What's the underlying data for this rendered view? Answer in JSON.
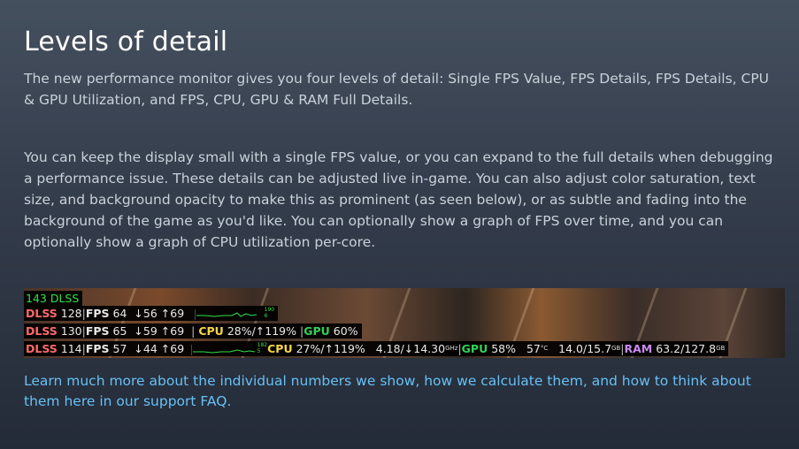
{
  "title": "Levels of detail",
  "para1": "The new performance monitor gives you four levels of detail: Single FPS Value, FPS Details, FPS Details, CPU & GPU Utilization, and FPS, CPU, GPU & RAM Full Details.",
  "para2": "You can keep the display small with a single FPS value, or you can expand to the full details when debugging a performance issue. These details can be adjusted live in-game. You can also adjust color saturation, text size, and background opacity to make this as prominent (as seen below), or as subtle and fading into the background of the game as you'd like. You can optionally show a graph of FPS over time, and you can optionally show a graph of CPU utilization per-core.",
  "link": "Learn much more about the individual numbers we show, how we calculate them, and how to think about them here in our support FAQ.",
  "overlay": {
    "row0": "143 DLSS",
    "row1": {
      "dlss_label": "DLSS",
      "dlss_val": "128",
      "fps_label": "FPS",
      "fps_val": "64",
      "low": "↓56",
      "high": "↑69",
      "graph_max": "190",
      "graph_min": "6"
    },
    "row2": {
      "dlss_label": "DLSS",
      "dlss_val": "130",
      "fps_label": "FPS",
      "fps_val": "65",
      "low": "↓59",
      "high": "↑69",
      "cpu_label": "CPU",
      "cpu_val": "28%/↑119%",
      "gpu_label": "GPU",
      "gpu_val": "60%"
    },
    "row3": {
      "dlss_label": "DLSS",
      "dlss_val": "114",
      "fps_label": "FPS",
      "fps_val": "57",
      "low": "↓44",
      "high": "↑69",
      "graph_max": "182",
      "graph_min": "5",
      "cpu_label": "CPU",
      "cpu_val": "27%/↑119%",
      "clock": "4.18/↓14.30",
      "clock_unit": "GHz",
      "gpu_label": "GPU",
      "gpu_val": "58%",
      "temp": "57",
      "temp_unit": "°C",
      "vram": "14.0/15.7",
      "vram_unit": "GB",
      "ram_label": "RAM",
      "ram_val": "63.2/127.8",
      "ram_unit": "GB"
    }
  },
  "colors": {
    "title": "#ffffff",
    "body": "#c9d1da",
    "link": "#66c0f4",
    "fps_green": "#2ee04a",
    "dlss_red": "#ff6b6b",
    "cpu_yellow": "#f5d547",
    "gpu_green": "#34d058",
    "ram_purple": "#c78af0"
  }
}
